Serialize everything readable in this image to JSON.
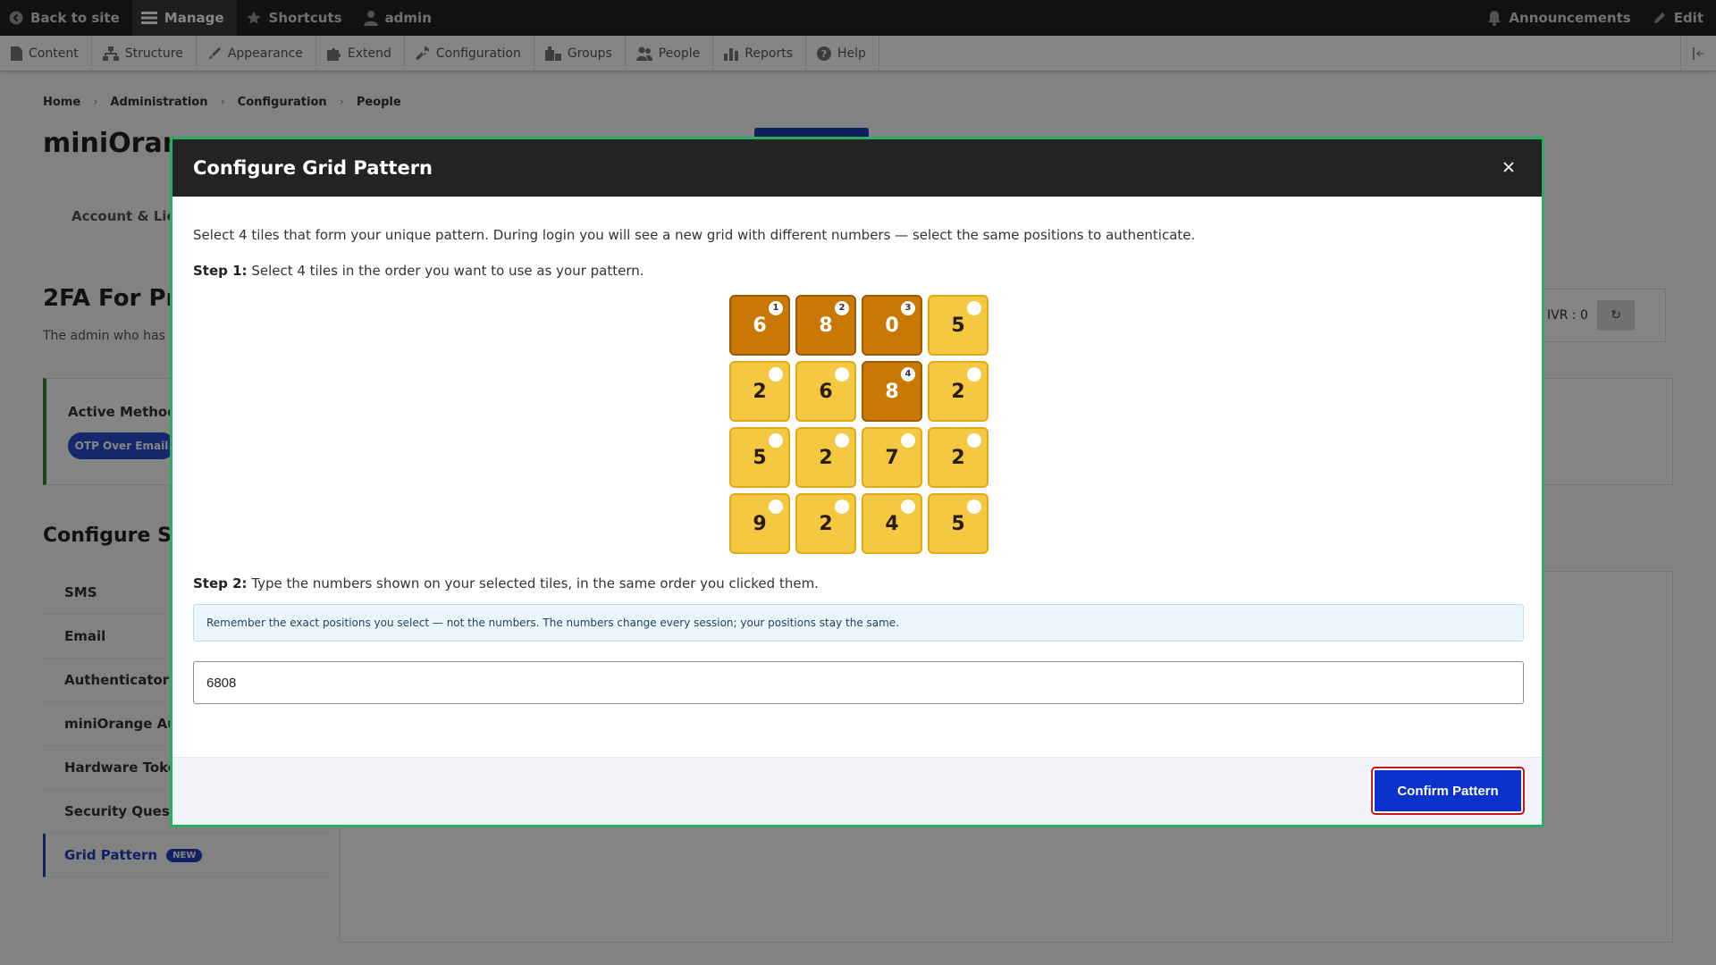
{
  "toolbar": {
    "back_to_site": "Back to site",
    "manage": "Manage",
    "shortcuts": "Shortcuts",
    "user": "admin",
    "announcements": "Announcements",
    "edit": "Edit"
  },
  "tray": {
    "items": [
      "Content",
      "Structure",
      "Appearance",
      "Extend",
      "Configuration",
      "Groups",
      "People",
      "Reports",
      "Help"
    ]
  },
  "breadcrumb": [
    "Home",
    "Administration",
    "Configuration",
    "People"
  ],
  "page": {
    "title_visible": "miniOran",
    "tab_visible": "Account & Lic",
    "h2_visible": "2FA For Pr",
    "desc_visible": "The admin who has",
    "active_method_label": "Active Method",
    "active_method_value": "OTP Over Email",
    "ivr_text": "IVR : 0",
    "ivr_refresh_icon": "refresh-icon",
    "configure_visible": "Configure Se",
    "methods": [
      "SMS",
      "Email",
      "Authenticator A",
      "miniOrange Aut",
      "Hardware Toker",
      "Security Questio",
      "Grid Pattern"
    ],
    "new_badge": "NEW"
  },
  "modal": {
    "title": "Configure Grid Pattern",
    "intro": "Select 4 tiles that form your unique pattern. During login you will see a new grid with different numbers — select the same positions to authenticate.",
    "step1_label": "Step 1:",
    "step1_text": " Select 4 tiles in the order you want to use as your pattern.",
    "step2_label": "Step 2:",
    "step2_text": " Type the numbers shown on your selected tiles, in the same order you clicked them.",
    "info": "Remember the exact positions you select — not the numbers. The numbers change every session; your positions stay the same.",
    "input_value": "6808",
    "confirm_label": "Confirm Pattern",
    "grid": [
      {
        "value": "6",
        "order": "1"
      },
      {
        "value": "8",
        "order": "2"
      },
      {
        "value": "0",
        "order": "3"
      },
      {
        "value": "5",
        "order": ""
      },
      {
        "value": "2",
        "order": ""
      },
      {
        "value": "6",
        "order": ""
      },
      {
        "value": "8",
        "order": "4"
      },
      {
        "value": "2",
        "order": ""
      },
      {
        "value": "5",
        "order": ""
      },
      {
        "value": "2",
        "order": ""
      },
      {
        "value": "7",
        "order": ""
      },
      {
        "value": "2",
        "order": ""
      },
      {
        "value": "9",
        "order": ""
      },
      {
        "value": "2",
        "order": ""
      },
      {
        "value": "4",
        "order": ""
      },
      {
        "value": "5",
        "order": ""
      }
    ]
  },
  "colors": {
    "modal_border": "#27ae60",
    "tile": "#f5c842",
    "tile_selected": "#c97806",
    "confirm": "#0a31c9",
    "confirm_outline": "#c41920"
  }
}
